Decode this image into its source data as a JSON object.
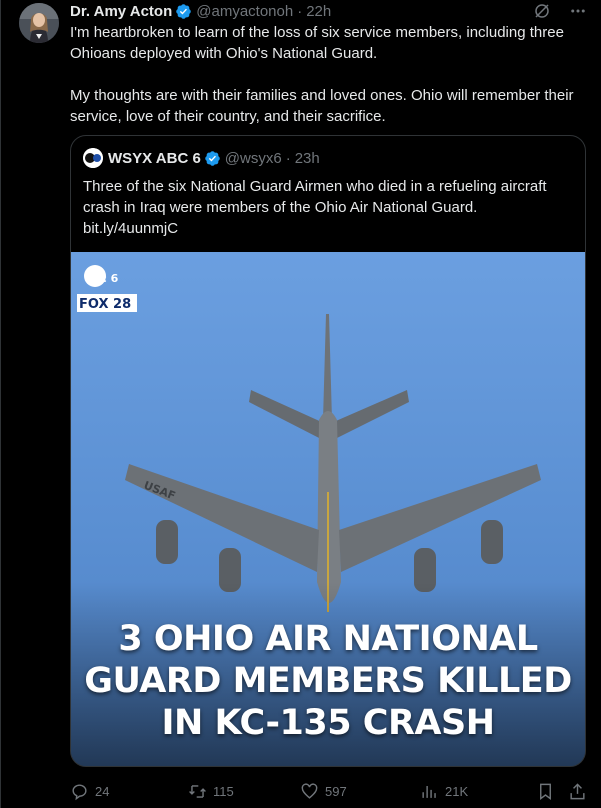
{
  "author": {
    "name": "Dr. Amy Acton",
    "handle": "@amyactonoh",
    "separator": "·",
    "time": "22h"
  },
  "tweet": {
    "paragraph_1": "I'm heartbroken to learn of the loss of six service members, including three Ohioans deployed with Ohio's National Guard.",
    "paragraph_2": "My thoughts are with their families and loved ones. Ohio will remember their service, love of their country, and their sacrifice."
  },
  "quote": {
    "author_name": "WSYX ABC 6",
    "handle": "@wsyx6",
    "separator": "·",
    "time": "23h",
    "text": "Three of the six National Guard Airmen who died in a refueling aircraft crash in Iraq were members of the Ohio Air National Guard.",
    "link": "bit.ly/4uunmjC",
    "media": {
      "logo_top": "abc 6",
      "logo_bottom": "FOX 28",
      "wing_marking": "USAF",
      "headline_line_1": "3 OHIO AIR NATIONAL",
      "headline_line_2": "GUARD MEMBERS KILLED",
      "headline_line_3": "IN KC-135 CRASH"
    }
  },
  "actions": {
    "replies": "24",
    "reposts": "115",
    "likes": "597",
    "views": "21K"
  },
  "icons": {
    "verified": "verified-badge-icon",
    "grok": "grok-icon",
    "more": "more-dots-icon",
    "reply": "reply-icon",
    "repost": "repost-icon",
    "like": "heart-icon",
    "views": "views-icon",
    "bookmark": "bookmark-icon",
    "share": "share-icon"
  },
  "colors": {
    "background": "#000000",
    "text": "#e7e9ea",
    "muted": "#71767b",
    "verified": "#1d9bf0",
    "border": "#2f3336",
    "sky": "#5d95da"
  }
}
